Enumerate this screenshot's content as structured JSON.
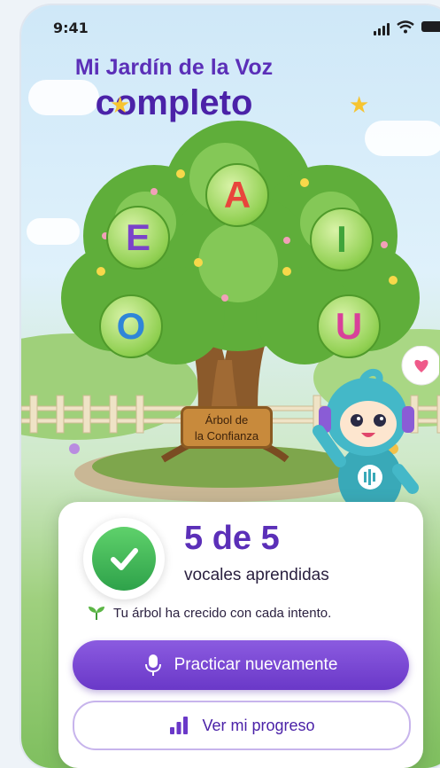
{
  "status_bar": {
    "time": "9:41"
  },
  "header": {
    "title_line1": "Mi Jardín de la Voz",
    "title_line2": "completo"
  },
  "tree": {
    "vowels": [
      "A",
      "E",
      "I",
      "O",
      "U"
    ],
    "vowel_colors": {
      "A": "#e8453c",
      "E": "#7a43c9",
      "I": "#3fa43a",
      "O": "#2f86d8",
      "U": "#d8409a"
    },
    "sign_line1": "Árbol de",
    "sign_line2": "la Confianza"
  },
  "result_card": {
    "count_text": "5 de 5",
    "count_sub": "vocales aprendidas",
    "note": "Tu árbol ha crecido con cada intento.",
    "primary_button": "Practicar nuevamente",
    "secondary_button": "Ver mi progreso"
  },
  "colors": {
    "accent": "#6a38c8",
    "success": "#2ea24a"
  }
}
